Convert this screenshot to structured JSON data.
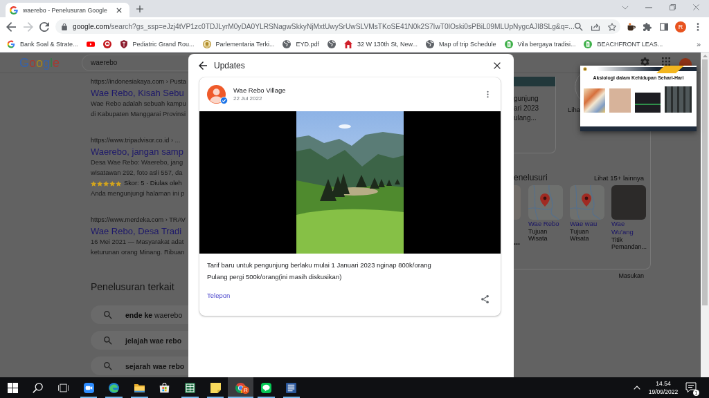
{
  "browser": {
    "tab": {
      "title": "waerebo - Penelusuran Google",
      "selected": true
    },
    "forward_disabled": true,
    "url_host": "google.com",
    "url_rest": "/search?gs_ssp=eJzj4tVP1zc0TDJLyrM0yDA0YLRSNagwSkkyNjMxtUwySrUwSLVMsTKoSE41N0k2S7IwT0lOski0sPBiL09MLUpNygcAJI8SLg&q=...",
    "profile_initial": "R",
    "bookmarks": [
      {
        "kind": "labeled",
        "label": "Bank Soal & Strate..."
      },
      {
        "kind": "icon_only"
      },
      {
        "kind": "icon_only"
      },
      {
        "kind": "labeled",
        "label": "Pediatric Grand Rou..."
      },
      {
        "kind": "labeled",
        "label": "Parlementaria Terki..."
      },
      {
        "kind": "labeled",
        "label": "EYD.pdf"
      },
      {
        "kind": "icon_only"
      },
      {
        "kind": "labeled",
        "label": "32 W 130th St, New..."
      },
      {
        "kind": "labeled",
        "label": "Map of trip Schedule"
      },
      {
        "kind": "labeled",
        "label": "Vila bergaya tradisi..."
      },
      {
        "kind": "labeled",
        "label": "BEACHFRONT LEAS..."
      }
    ],
    "more_bookmarks": "»"
  },
  "search_page": {
    "logo": "Google",
    "query": "waerebo",
    "results": [
      {
        "url": "https://indonesiakaya.com › Pusta",
        "title": "Wae Rebo, Kisah Sebu",
        "snippet": "Wae Rebo adalah sebuah kampu\ndi Kabupaten Manggarai Provinsi"
      },
      {
        "url": "https://www.tripadvisor.co.id › ...",
        "title": "Waerebo, jangan samp",
        "snippet": "Desa Wae Rebo: Waerebo, jang\nwisatawan 292, foto asli 557, da",
        "rating": {
          "stars": 5,
          "text": "Skor: 5 · Diulas oleh"
        },
        "visited_note": "Anda mengunjungi halaman ini p"
      },
      {
        "url": "https://www.merdeka.com › TRAV",
        "title": "Wae Rebo, Desa Tradi",
        "snippet": "16 Mei 2021 — Masyarakat adat\nketurunan orang Minang. Ribuan"
      }
    ],
    "related_heading": "Penelusuran terkait",
    "related": [
      {
        "text": "**ende ke** waerebo",
        "bold": false
      },
      {
        "text": "jelajah wae rebo",
        "bold": true
      },
      {
        "text": "sejarah wae rebo",
        "bold": true
      }
    ]
  },
  "side_panel": {
    "update_preview": "gunjung\nari 2023\nulang...",
    "more_label": "Liha",
    "heading": "enelusuri",
    "see_more": "Lihat 15+ lainnya",
    "places": [
      {
        "kind": "partial",
        "subtitle": "..."
      },
      {
        "kind": "map",
        "title": "Wae Rebo",
        "subtitle": "Tujuan Wisata"
      },
      {
        "kind": "map",
        "title": "Wae wau",
        "subtitle": "Tujuan Wisata"
      },
      {
        "kind": "photo",
        "title": "Wae Wu'ang",
        "subtitle": "Titik Pemandan..."
      }
    ],
    "feedback": "Masukan"
  },
  "modal": {
    "title": "Updates",
    "post": {
      "author": "Wae Rebo Village",
      "verified": true,
      "date": "22 Jul 2022",
      "text": "Tarif baru untuk pengunjung berlaku mulai 1 Januari 2023 nginap 800k/orang\nPulang pergi 500k/orang(ini masih diskusikan)",
      "action": "Telepon"
    }
  },
  "floating_window": {
    "slide_title": "Aksiologi dalam Kehidupan Sehari-Hari"
  },
  "taskbar": {
    "apps": [
      {
        "running": true,
        "selected": false
      },
      {
        "running": true,
        "selected": false
      },
      {
        "running": true,
        "selected": false
      },
      {
        "running": false,
        "selected": false
      },
      {
        "running": true,
        "selected": false
      },
      {
        "running": true,
        "selected": false
      },
      {
        "running": true,
        "selected": true,
        "badge": "R"
      },
      {
        "running": true,
        "selected": false
      },
      {
        "running": true,
        "selected": false
      }
    ],
    "time": "14.54",
    "date": "19/09/2022",
    "notification_count": "1"
  }
}
